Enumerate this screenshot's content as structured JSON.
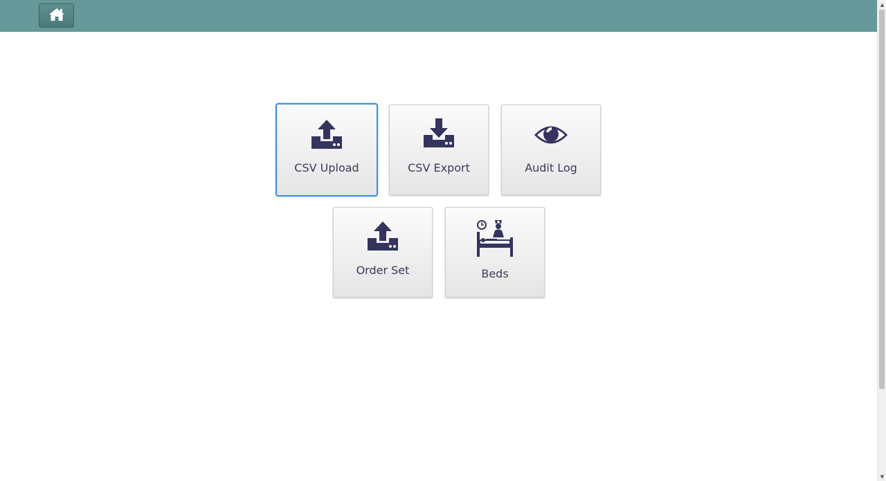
{
  "header": {
    "home_icon": "home-icon",
    "bar_color": "#669999"
  },
  "tiles": [
    {
      "label": "CSV Upload",
      "icon": "upload-icon",
      "active": true
    },
    {
      "label": "CSV Export",
      "icon": "download-icon",
      "active": false
    },
    {
      "label": "Audit Log",
      "icon": "eye-icon",
      "active": false
    },
    {
      "label": "Order Set",
      "icon": "upload-icon",
      "active": false
    },
    {
      "label": "Beds",
      "icon": "hospital-bed-icon",
      "active": false
    }
  ],
  "colors": {
    "icon": "#34345f",
    "active_border": "#3a8ee6"
  }
}
